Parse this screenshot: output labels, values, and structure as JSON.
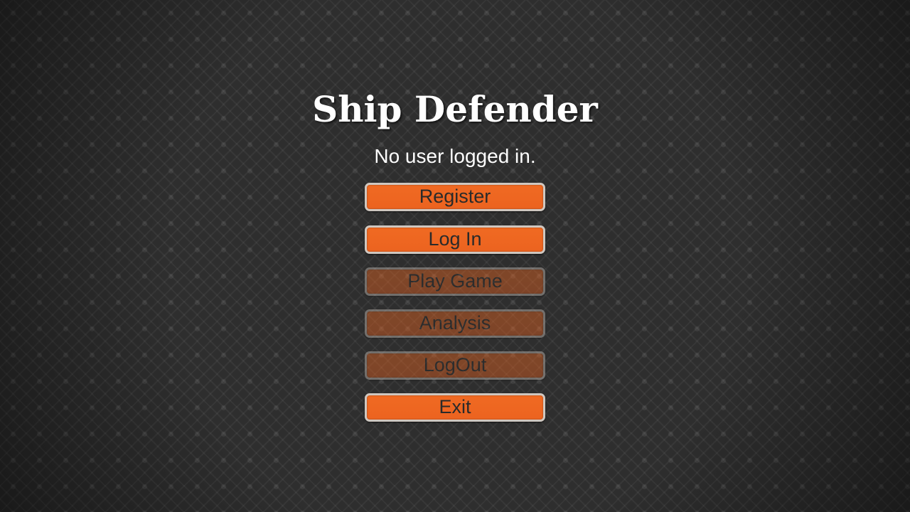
{
  "title": "Ship Defender",
  "status": "No user logged in.",
  "colors": {
    "button_fill": "#ec6320",
    "button_border": "#cfc7c0",
    "button_text": "#2a2a2a",
    "background": "#2e2e2e",
    "title_text": "#ffffff"
  },
  "buttons": [
    {
      "label": "Register",
      "enabled": true
    },
    {
      "label": "Log In",
      "enabled": true
    },
    {
      "label": "Play Game",
      "enabled": false
    },
    {
      "label": "Analysis",
      "enabled": false
    },
    {
      "label": "LogOut",
      "enabled": false
    },
    {
      "label": "Exit",
      "enabled": true
    }
  ]
}
